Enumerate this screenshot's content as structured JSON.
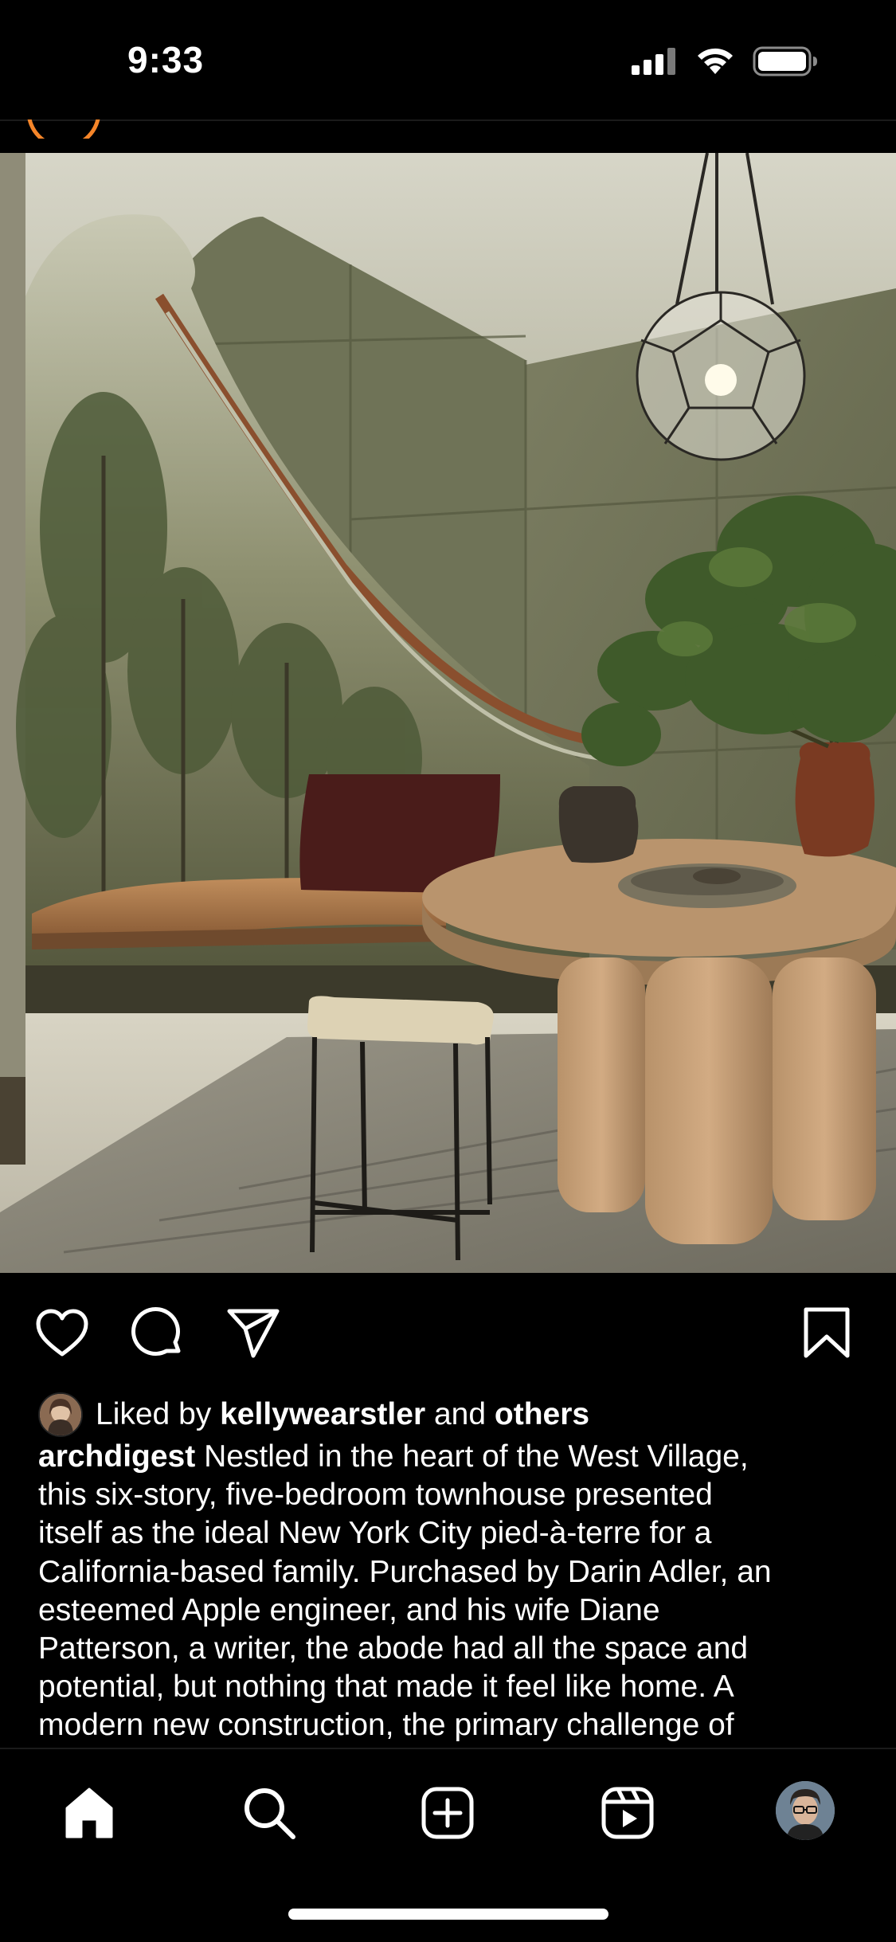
{
  "status_bar": {
    "time": "9:33",
    "icons": [
      "cellular-signal-icon",
      "wifi-icon",
      "battery-icon"
    ]
  },
  "post": {
    "image": {
      "icon": "interior-photo",
      "description_visible": false
    },
    "actions": {
      "like": {
        "icon": "heart-icon"
      },
      "comment": {
        "icon": "comment-bubble-icon"
      },
      "share": {
        "icon": "paper-plane-icon"
      },
      "save": {
        "icon": "bookmark-icon"
      }
    },
    "likes": {
      "prefix": "Liked by",
      "user": "kellywearstler",
      "joiner": "and",
      "others": "others"
    },
    "caption": {
      "username": "archdigest",
      "text": "Nestled in the heart of the West Village,\nthis six-story, five-bedroom townhouse presented\nitself as the ideal New York City pied-à-terre for a\nCalifornia-based family. Purchased by Darin Adler, an\nesteemed Apple engineer, and his wife Diane\nPatterson, a writer, the abode had all the space and\npotential, but nothing that made it feel like home. A\nmodern new construction, the primary challenge of"
    }
  },
  "tab_bar": {
    "items": [
      {
        "name": "home",
        "icon": "home-icon",
        "active": true
      },
      {
        "name": "search",
        "icon": "search-icon",
        "active": false
      },
      {
        "name": "create",
        "icon": "plus-square-icon",
        "active": false
      },
      {
        "name": "reels",
        "icon": "reels-icon",
        "active": false
      },
      {
        "name": "profile",
        "icon": "profile-avatar",
        "active": false
      }
    ]
  },
  "colors": {
    "background": "#000000",
    "text": "#ffffff",
    "story_ring": "#f58529"
  }
}
